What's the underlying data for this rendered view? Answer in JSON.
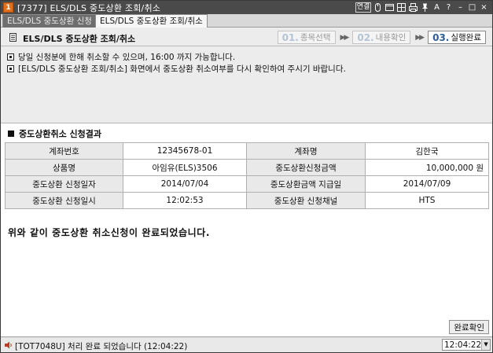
{
  "window": {
    "app_badge": "1",
    "title": "[7377] ELS/DLS 중도상환 조회/취소",
    "tools": [
      "link-icon",
      "mouse-icon",
      "window-icon",
      "grid-icon",
      "print-icon",
      "pin-icon",
      "zoom-text-icon",
      "help-icon",
      "minimize-icon",
      "maximize-icon",
      "close-icon"
    ],
    "tool_labels": {
      "link": "연결",
      "zoom": "A",
      "help": "?",
      "minimize": "–",
      "maximize": "□",
      "close": "×"
    }
  },
  "tabs": [
    {
      "label": "ELS/DLS 중도상환 신청",
      "active": false
    },
    {
      "label": "ELS/DLS 중도상환 조회/취소",
      "active": true
    }
  ],
  "header": {
    "title": "ELS/DLS 중도상환 조회/취소",
    "steps": [
      {
        "num": "01.",
        "label": "종목선택",
        "current": false
      },
      {
        "num": "02.",
        "label": "내용확인",
        "current": false
      },
      {
        "num": "03.",
        "label": "실행완료",
        "current": true
      }
    ]
  },
  "notices": [
    "당일 신청분에 한해 취소할 수 있으며, 16:00 까지 가능합니다.",
    "[ELS/DLS 중도상환 조회/취소] 화면에서 중도상환 취소여부를 다시 확인하여 주시기 바랍니다."
  ],
  "result": {
    "title": "중도상환취소 신청결과",
    "rows": [
      {
        "l1": "계좌번호",
        "v1": "12345678-01",
        "l2": "계좌명",
        "v2": "김한국"
      },
      {
        "l1": "상품명",
        "v1": "아임유(ELS)3506",
        "l2": "중도상환신청금액",
        "v2": "10,000,000 원"
      },
      {
        "l1": "중도상환 신청일자",
        "v1": "2014/07/04",
        "l2": "중도상환금액 지급일",
        "v2": "2014/07/09"
      },
      {
        "l1": "중도상환 신청일시",
        "v1": "12:02:53",
        "l2": "중도상환 신청채널",
        "v2": "HTS"
      }
    ],
    "message": "위와 같이 중도상환 취소신청이 완료되었습니다.",
    "confirm_label": "완료확인"
  },
  "status": {
    "message": "[TOT7048U] 처리 완료 되었습니다 (12:04:22)",
    "time": "12:04:22"
  },
  "colors": {
    "titlebar": "#4a4a4a",
    "badge": "#e0701c",
    "step_current": "#2f5f95",
    "panel_bg": "#ffffff",
    "window_bg": "#ececec"
  }
}
